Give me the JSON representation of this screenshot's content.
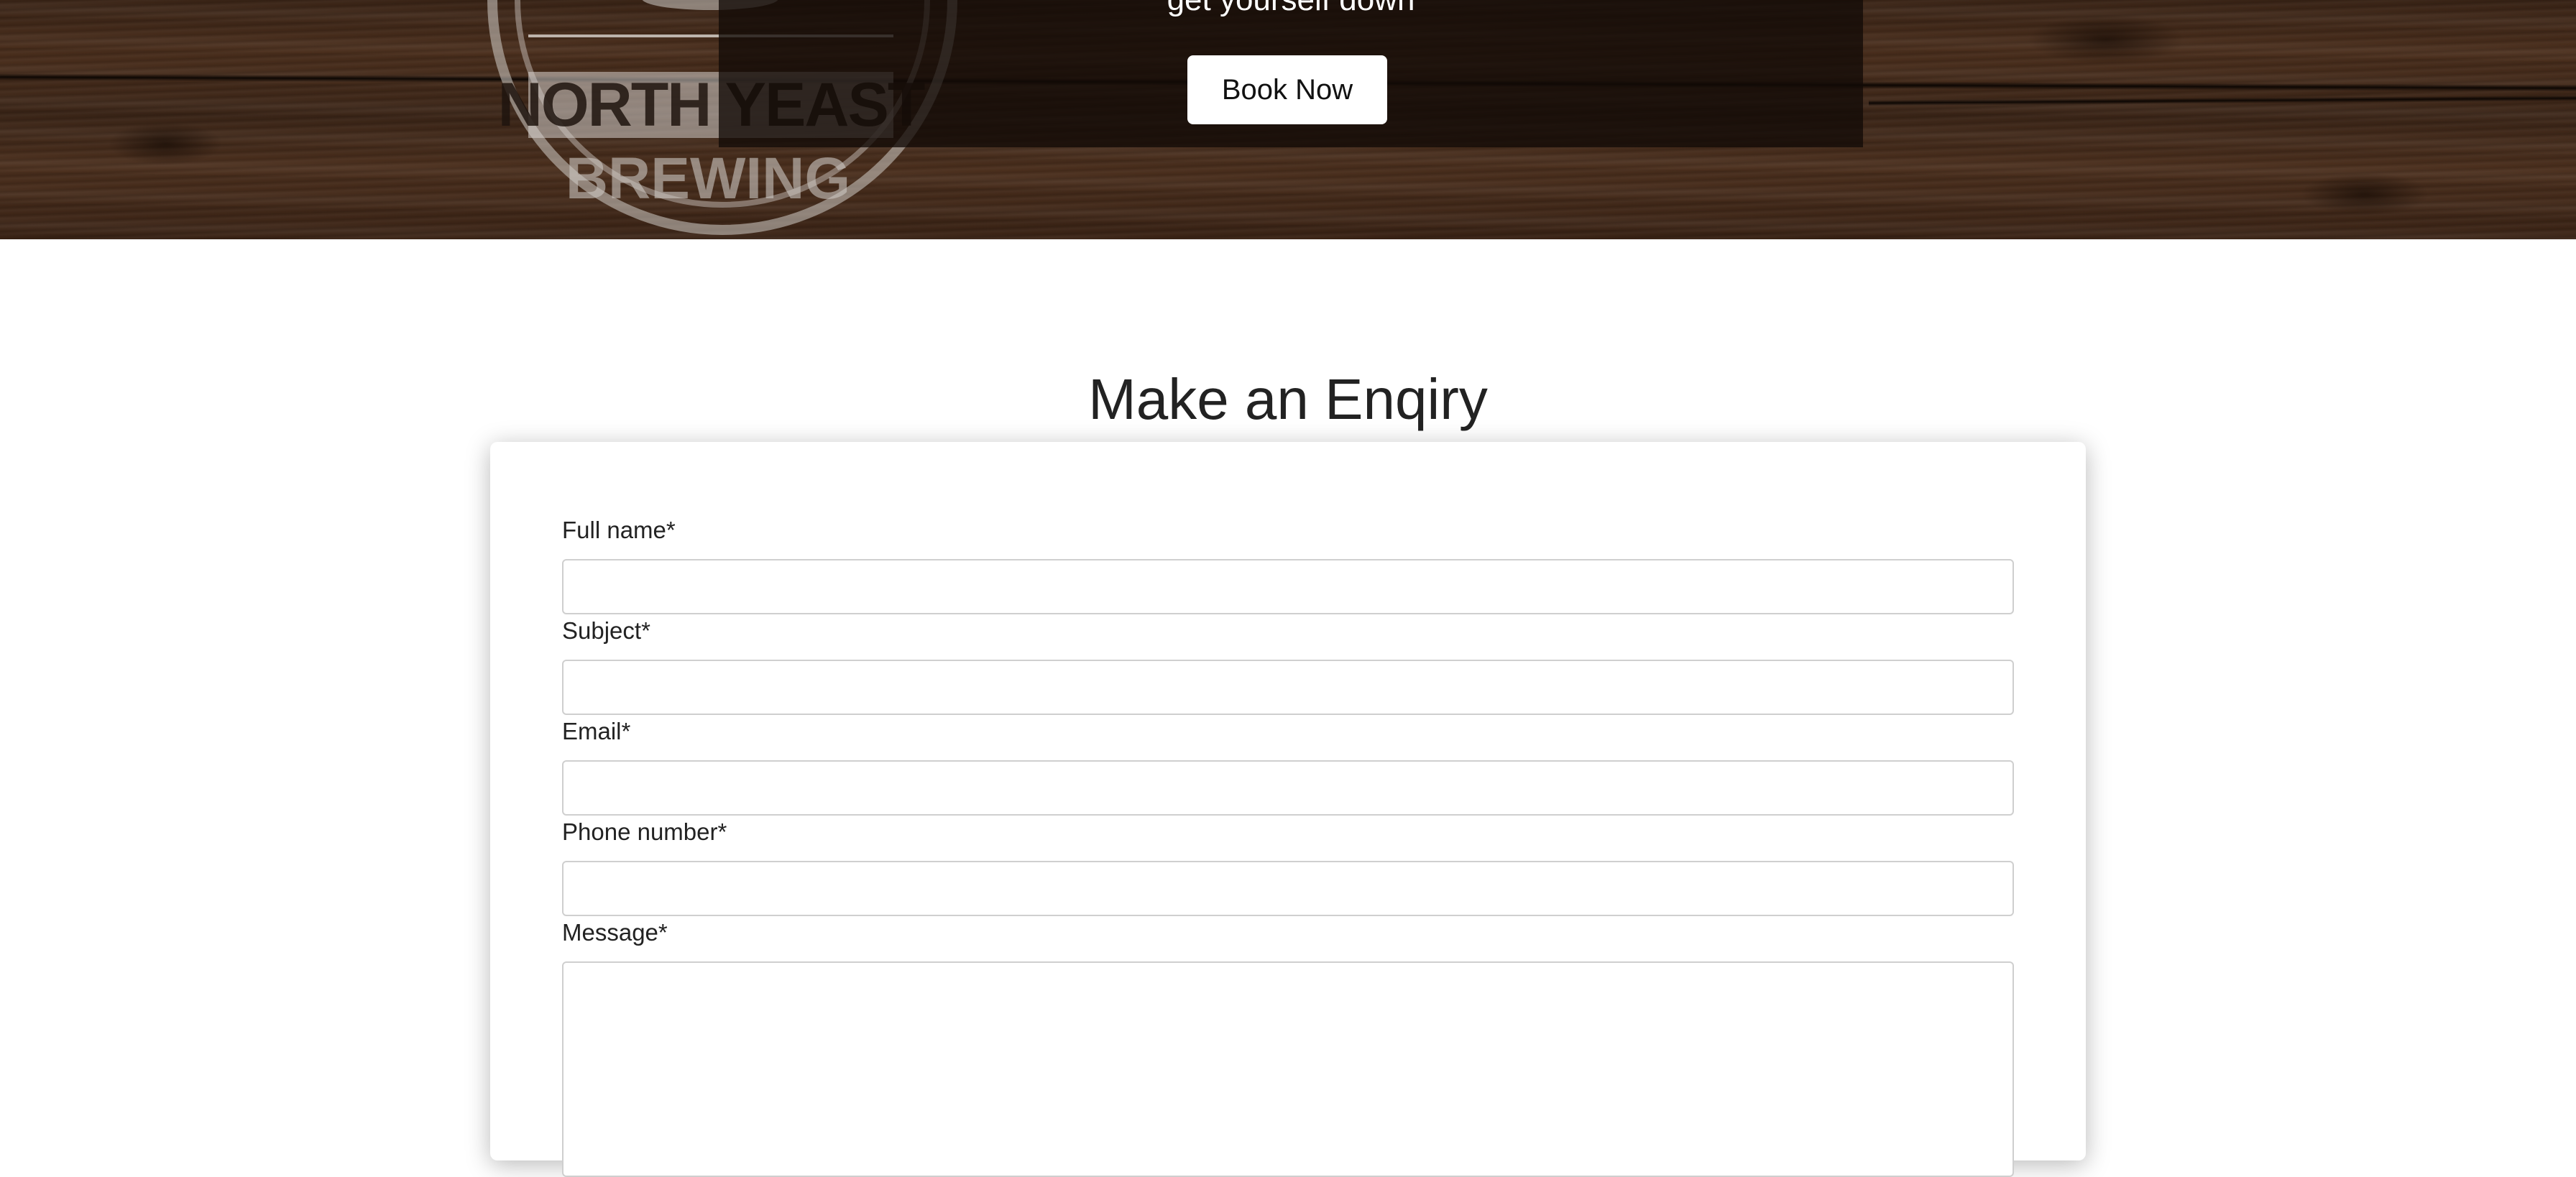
{
  "hero": {
    "tagline": "get yourself down",
    "book_button_label": "Book Now",
    "logo": {
      "line1": "NORTH YEAST",
      "line2": "BREWING"
    }
  },
  "enquiry": {
    "title": "Make an Enqiry",
    "fields": [
      {
        "label": "Full name*",
        "value": ""
      },
      {
        "label": "Subject*",
        "value": ""
      },
      {
        "label": "Email*",
        "value": ""
      },
      {
        "label": "Phone number*",
        "value": ""
      },
      {
        "label": "Message*",
        "value": ""
      }
    ]
  },
  "colors": {
    "wood_dark": "#3a2416",
    "overlay": "#120a06",
    "button_bg": "#ffffff",
    "text": "#222222",
    "input_border": "#cfcfcf"
  }
}
